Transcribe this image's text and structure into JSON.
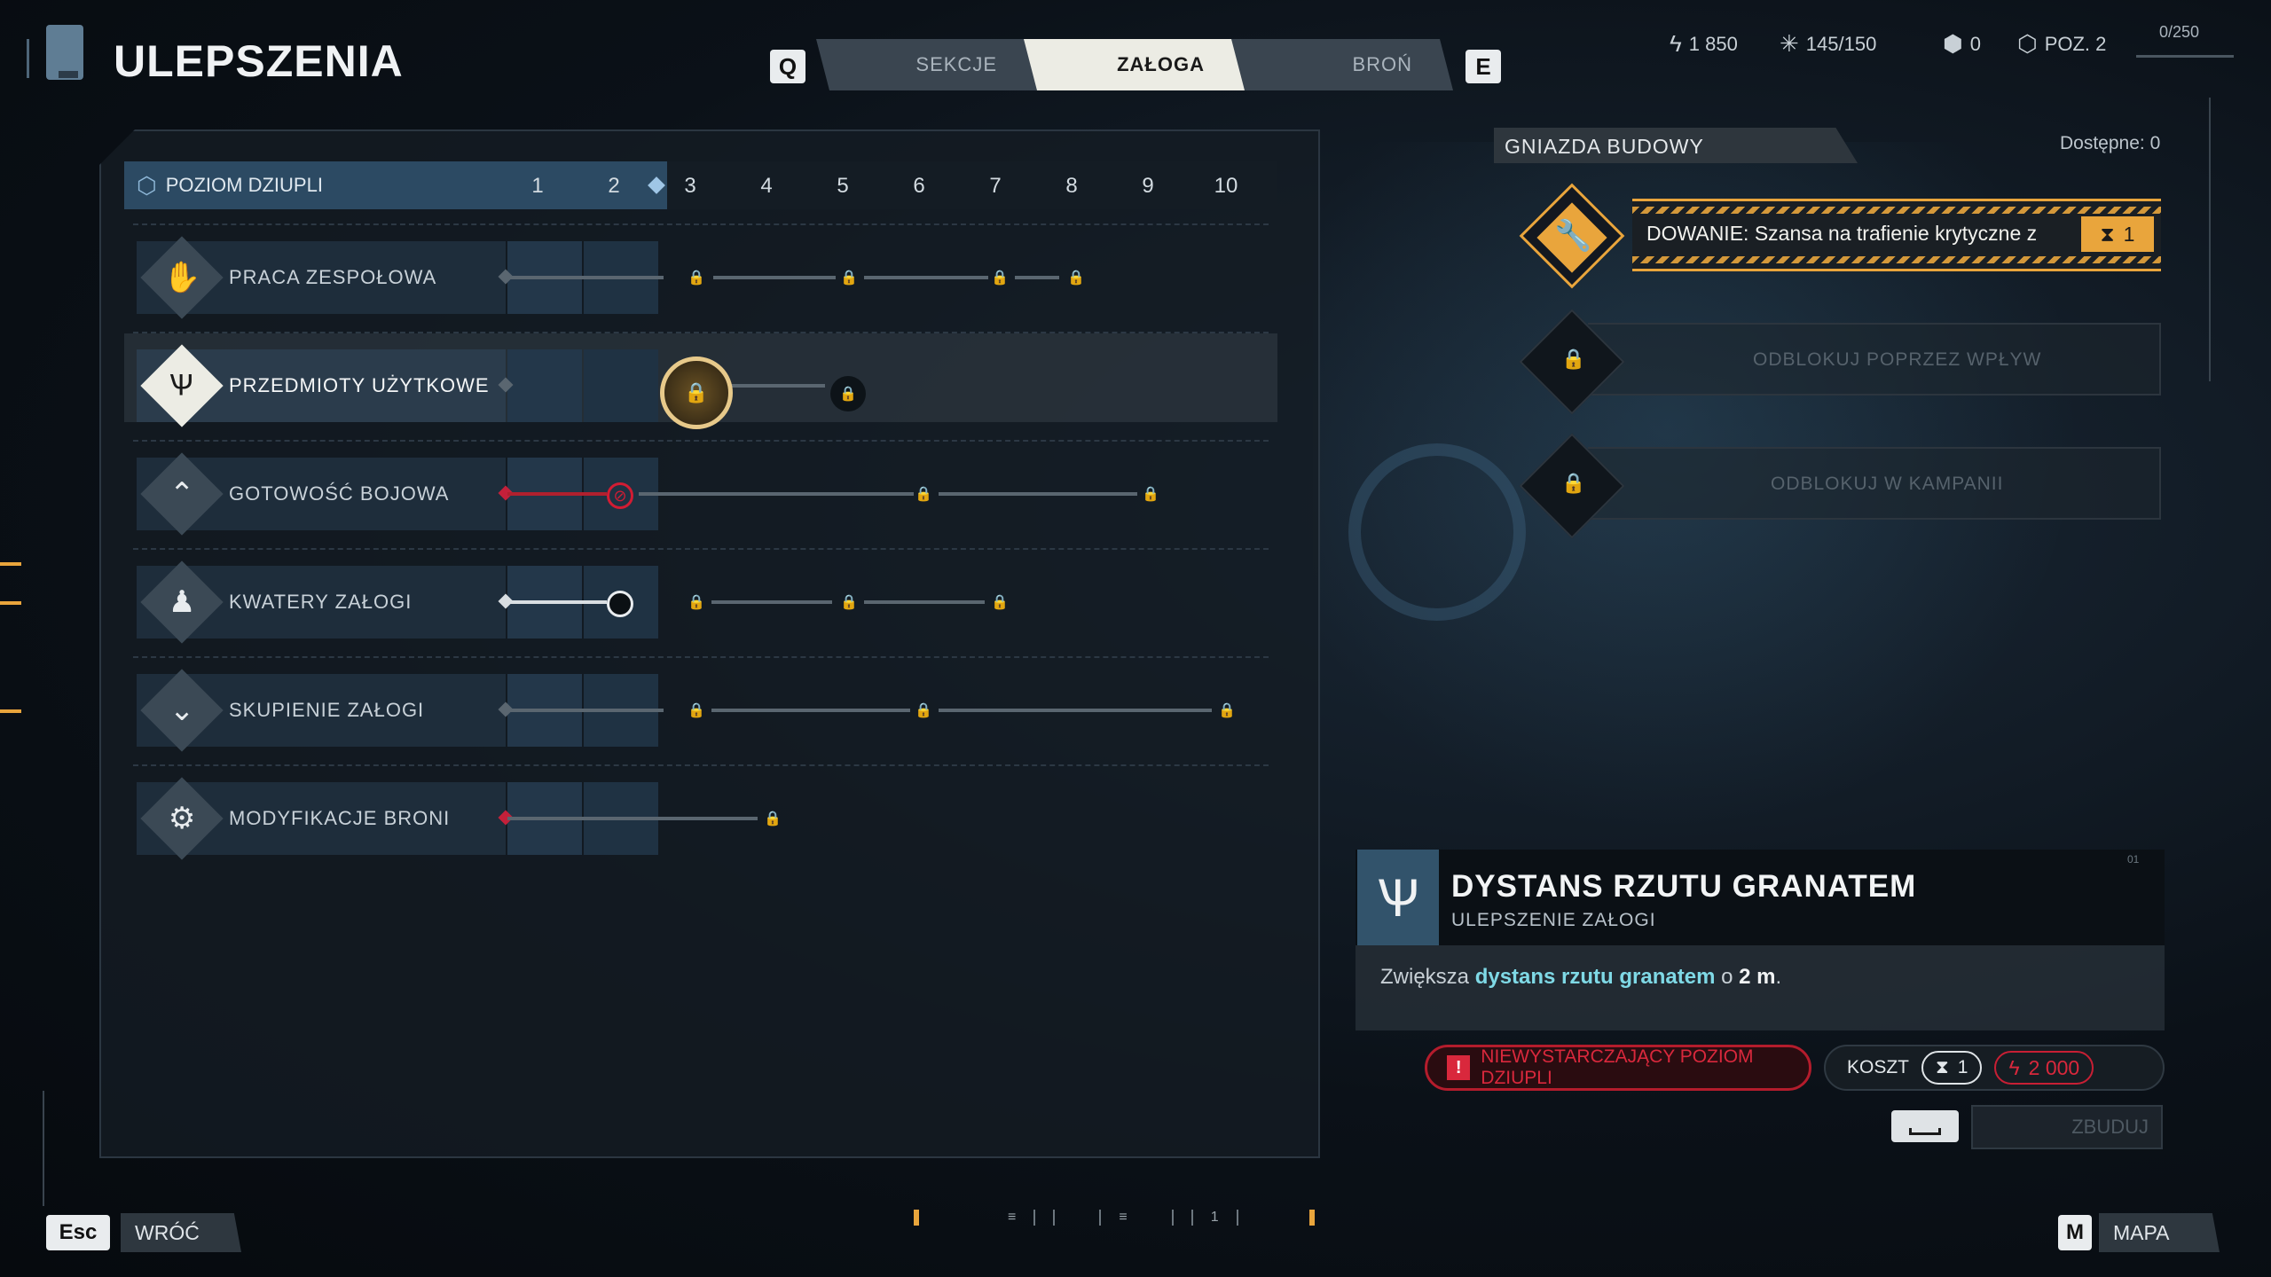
{
  "header": {
    "title": "ULEPSZENIA",
    "key_prev": "Q",
    "key_next": "E",
    "tabs": [
      {
        "label": "SEKCJE",
        "active": false
      },
      {
        "label": "ZAŁOGA",
        "active": true
      },
      {
        "label": "BROŃ",
        "active": false
      }
    ],
    "resources": {
      "currency": "1 850",
      "supplies": "145/150",
      "tokens": "0",
      "level": "POZ. 2",
      "xp": "0/250"
    }
  },
  "tree": {
    "level_label": "POZIOM DZIUPLI",
    "levels": [
      "1",
      "2",
      "3",
      "4",
      "5",
      "6",
      "7",
      "8",
      "9",
      "10"
    ],
    "current_level": 2,
    "rows": [
      {
        "label": "PRACA ZESPOŁOWA",
        "icon": "hands-icon"
      },
      {
        "label": "PRZEDMIOTY UŻYTKOWE",
        "icon": "grenade-claw-icon",
        "selected": true
      },
      {
        "label": "GOTOWOŚĆ BOJOWA",
        "icon": "chevron-up-icon"
      },
      {
        "label": "KWATERY ZAŁOGI",
        "icon": "bunk-icon"
      },
      {
        "label": "SKUPIENIE ZAŁOGI",
        "icon": "focus-icon"
      },
      {
        "label": "MODYFIKACJE BRONI",
        "icon": "gear-icon"
      }
    ]
  },
  "sockets": {
    "title": "GNIAZDA BUDOWY",
    "available": "Dostępne: 0",
    "items": [
      {
        "text": "DOWANIE: Szansa na trafienie krytyczne z",
        "badge": "1",
        "icon": "wrench-icon"
      },
      {
        "text": "ODBLOKUJ POPRZEZ WPŁYW",
        "icon": "lock-icon"
      },
      {
        "text": "ODBLOKUJ W KAMPANII",
        "icon": "lock-icon"
      }
    ]
  },
  "detail": {
    "title": "DYSTANS RZUTU GRANATEM",
    "subtitle": "ULEPSZENIE ZAŁOGI",
    "num": "01",
    "desc_prefix": "Zwiększa ",
    "desc_highlight": "dystans rzutu granatem",
    "desc_mid": " o ",
    "desc_value": "2 m",
    "desc_suffix": ".",
    "warning": "NIEWYSTARCZAJĄCY POZIOM DZIUPLI",
    "cost_label": "KOSZT",
    "cost_time": "1",
    "cost_currency": "2 000",
    "build_label": "ZBUDUJ"
  },
  "footer": {
    "back_key": "Esc",
    "back_label": "WRÓĆ",
    "map_key": "M",
    "map_label": "MAPA",
    "pager_marks": [
      "≡",
      "≡",
      "1"
    ]
  },
  "colors": {
    "accent": "#e9a53c",
    "alert": "#d9283c",
    "highlight": "#7fd9e6",
    "panel": "#2c4a63"
  }
}
